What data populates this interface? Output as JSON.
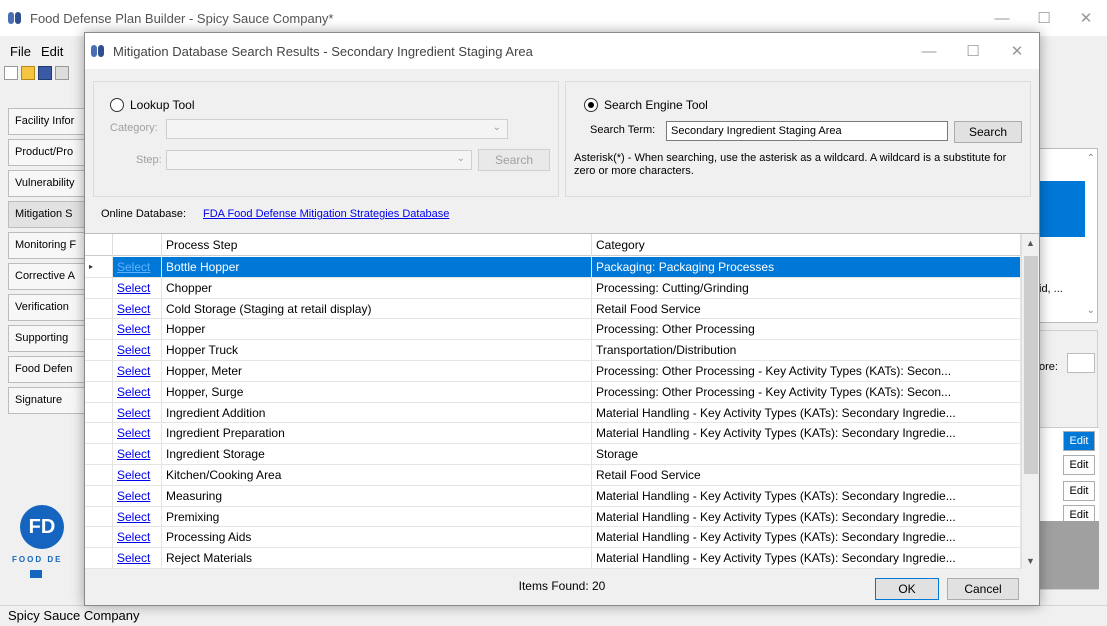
{
  "main": {
    "title": "Food Defense Plan Builder - Spicy Sauce Company*",
    "menu": [
      "File",
      "Edit"
    ],
    "nav": [
      "Facility Infor",
      "Product/Pro",
      "Vulnerability",
      "Mitigation S",
      "Monitoring F",
      "Corrective A",
      "Verification",
      "Supporting",
      "Food Defen",
      "Signature"
    ],
    "logo_text": "FD",
    "logo_caption": "FOOD DE",
    "status": "Spicy Sauce Company",
    "right_snippet": "id, ...",
    "right_label": "ore:",
    "edit_label": "Edit"
  },
  "dialog": {
    "title": "Mitigation Database Search Results - Secondary Ingredient Staging Area",
    "lookup": {
      "radio_label": "Lookup Tool",
      "category_label": "Category:",
      "step_label": "Step:",
      "search_button": "Search"
    },
    "engine": {
      "radio_label": "Search Engine Tool",
      "term_label": "Search Term:",
      "term_value": "Secondary Ingredient Staging Area",
      "search_button": "Search",
      "help": "Asterisk(*) - When searching, use the asterisk as a wildcard.  A wildcard is a substitute for zero or more characters."
    },
    "online_label": "Online Database:",
    "online_link": "FDA Food Defense Mitigation Strategies Database",
    "columns": [
      "Process Step",
      "Category"
    ],
    "select_label": "Select",
    "rows": [
      {
        "step": "Bottle Hopper",
        "category": "Packaging: Packaging Processes"
      },
      {
        "step": "Chopper",
        "category": "Processing: Cutting/Grinding"
      },
      {
        "step": "Cold Storage (Staging at retail display)",
        "category": "Retail Food Service"
      },
      {
        "step": "Hopper",
        "category": "Processing: Other Processing"
      },
      {
        "step": "Hopper Truck",
        "category": "Transportation/Distribution"
      },
      {
        "step": "Hopper, Meter",
        "category": "Processing: Other Processing - Key Activity Types (KATs): Secon..."
      },
      {
        "step": "Hopper, Surge",
        "category": "Processing: Other Processing - Key Activity Types (KATs): Secon..."
      },
      {
        "step": "Ingredient Addition",
        "category": "Material Handling - Key Activity Types (KATs): Secondary Ingredie..."
      },
      {
        "step": "Ingredient Preparation",
        "category": "Material Handling - Key Activity Types (KATs): Secondary Ingredie..."
      },
      {
        "step": "Ingredient Storage",
        "category": "Storage"
      },
      {
        "step": "Kitchen/Cooking Area",
        "category": "Retail Food Service"
      },
      {
        "step": "Measuring",
        "category": "Material Handling - Key Activity Types (KATs): Secondary Ingredie..."
      },
      {
        "step": "Premixing",
        "category": "Material Handling - Key Activity Types (KATs): Secondary Ingredie..."
      },
      {
        "step": "Processing Aids",
        "category": "Material Handling - Key Activity Types (KATs): Secondary Ingredie..."
      },
      {
        "step": "Reject Materials",
        "category": "Material Handling - Key Activity Types (KATs): Secondary Ingredie..."
      }
    ],
    "items_found": "Items Found:  20",
    "ok_button": "OK",
    "cancel_button": "Cancel"
  },
  "colors": {
    "selection": "#0078d7",
    "link": "#0000ee",
    "brand": "#1565c0"
  }
}
